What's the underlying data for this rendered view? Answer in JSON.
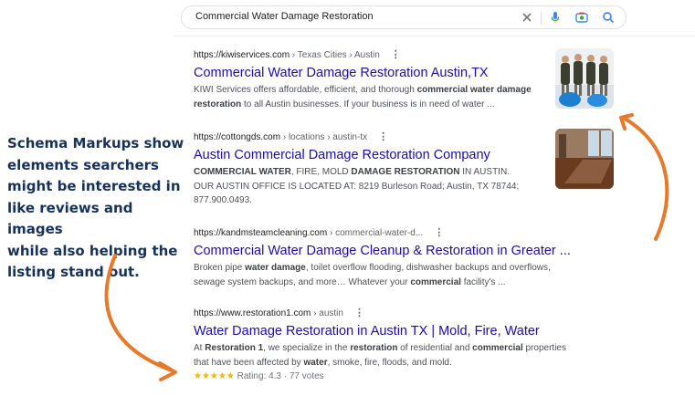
{
  "search": {
    "query": "Commercial Water Damage Restoration",
    "icons": [
      "close-icon",
      "mic-icon",
      "camera-icon",
      "search-icon"
    ]
  },
  "annotation": {
    "lines": [
      "Schema Markups show",
      "elements searchers",
      "might be interested in",
      "like reviews and images",
      "while also helping the",
      "listing stand out."
    ]
  },
  "results": [
    {
      "url": "https://kiwiservices.com",
      "crumb": " › Texas Cities › Austin",
      "title": "Commercial Water Damage Restoration Austin,TX",
      "snippet": [
        {
          "t": "KIWI Services offers affordable, efficient, and thorough ",
          "b": false
        },
        {
          "t": "commercial water damage restoration",
          "b": true
        },
        {
          "t": " to all Austin businesses. If your business is in need of water ...",
          "b": false
        }
      ]
    },
    {
      "url": "https://cottongds.com",
      "crumb": " › locations › austin-tx",
      "title": "Austin Commercial Damage Restoration Company",
      "snippet": [
        {
          "t": "COMMERCIAL WATER",
          "b": true
        },
        {
          "t": ", FIRE, MOLD ",
          "b": false
        },
        {
          "t": "DAMAGE RESTORATION",
          "b": true
        },
        {
          "t": " IN AUSTIN. OUR AUSTIN OFFICE IS LOCATED AT: 8219 Burleson Road; Austin, TX 78744; 877.900.0493.",
          "b": false
        }
      ]
    },
    {
      "url": "https://kandmsteamcleaning.com",
      "crumb": " › commercial-water-d...",
      "title": "Commercial Water Damage Cleanup & Restoration in Greater ...",
      "snippet": [
        {
          "t": "Broken pipe ",
          "b": false
        },
        {
          "t": "water damage",
          "b": true
        },
        {
          "t": ", toilet overflow flooding, dishwasher backups and overflows, sewage system backups, and more… Whatever your ",
          "b": false
        },
        {
          "t": "commercial",
          "b": true
        },
        {
          "t": " facility's ...",
          "b": false
        }
      ]
    },
    {
      "url": "https://www.restoration1.com",
      "crumb": " › austin",
      "title": "Water Damage Restoration in Austin TX | Mold, Fire, Water",
      "snippet": [
        {
          "t": "At ",
          "b": false
        },
        {
          "t": "Restoration 1",
          "b": true
        },
        {
          "t": ", we specialize in the ",
          "b": false
        },
        {
          "t": "restoration",
          "b": true
        },
        {
          "t": " of residential and ",
          "b": false
        },
        {
          "t": "commercial",
          "b": true
        },
        {
          "t": " properties that have been affected by ",
          "b": false
        },
        {
          "t": "water",
          "b": true
        },
        {
          "t": ", smoke, fire, floods, and mold.",
          "b": false
        }
      ],
      "rating": {
        "stars": "★★★★★",
        "label": "Rating: 4.3",
        "sep": " · ",
        "votes": "77 votes",
        "value": 4.3
      }
    }
  ],
  "colors": {
    "link": "#1a0dab",
    "annotation": "#16325c",
    "arrow": "#e8782a",
    "stars": "#f4b400"
  }
}
